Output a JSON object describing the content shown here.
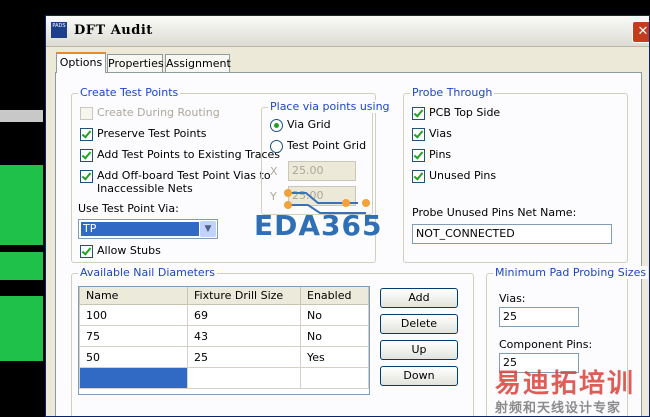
{
  "window": {
    "title": "DFT Audit",
    "close_glyph": "✕",
    "app_icon_text": "PADS"
  },
  "tabs": [
    "Options",
    "Properties",
    "Assignment"
  ],
  "create_test_points": {
    "title": "Create Test Points",
    "create_during_routing": {
      "label": "Create During Routing",
      "checked": false,
      "disabled": true
    },
    "preserve_test_points": {
      "label": "Preserve Test Points",
      "checked": true
    },
    "add_to_existing_traces": {
      "label": "Add Test Points to Existing Traces",
      "checked": true
    },
    "add_offboard_vias_line1": "Add Off-board Test Point Vias to",
    "add_offboard_vias_line2": "Inaccessible Nets",
    "add_offboard_checked": true,
    "use_test_point_via_label": "Use Test Point Via:",
    "use_test_point_via_value": "TP",
    "allow_stubs": {
      "label": "Allow Stubs",
      "checked": true
    }
  },
  "place_via": {
    "title": "Place via points using",
    "via_grid": {
      "label": "Via Grid",
      "selected": true
    },
    "test_point_grid": {
      "label": "Test Point Grid",
      "selected": false
    },
    "x_label": "X",
    "x_value": "25.00",
    "y_label": "Y",
    "y_value": "25.00"
  },
  "probe_through": {
    "title": "Probe Through",
    "items": [
      {
        "label": "PCB Top Side",
        "checked": true
      },
      {
        "label": "Vias",
        "checked": true
      },
      {
        "label": "Pins",
        "checked": true
      },
      {
        "label": "Unused Pins",
        "checked": true
      }
    ],
    "unused_net_label": "Probe Unused Pins Net Name:",
    "unused_net_value": "NOT_CONNECTED"
  },
  "nail_diameters": {
    "title": "Available Nail Diameters",
    "columns": [
      "Name",
      "Fixture Drill Size",
      "Enabled"
    ],
    "rows": [
      [
        "100",
        "69",
        "No"
      ],
      [
        "75",
        "43",
        "No"
      ],
      [
        "50",
        "25",
        "Yes"
      ]
    ],
    "buttons": [
      "Add",
      "Delete",
      "Up",
      "Down"
    ]
  },
  "min_pad": {
    "title": "Minimum Pad Probing Sizes",
    "vias_label": "Vias:",
    "vias_value": "25",
    "component_pins_label": "Component Pins:",
    "component_pins_value": "25"
  },
  "watermarks": {
    "eda": "EDA365",
    "cn_main": "易迪拓培训",
    "cn_sub": "射频和天线设计专家"
  },
  "colors": {
    "accent_group_title": "#1c47c3",
    "selection": "#316ac5",
    "check": "#21a121",
    "eda_blue": "#2f6fb5",
    "watermark_red": "#d8423a"
  }
}
